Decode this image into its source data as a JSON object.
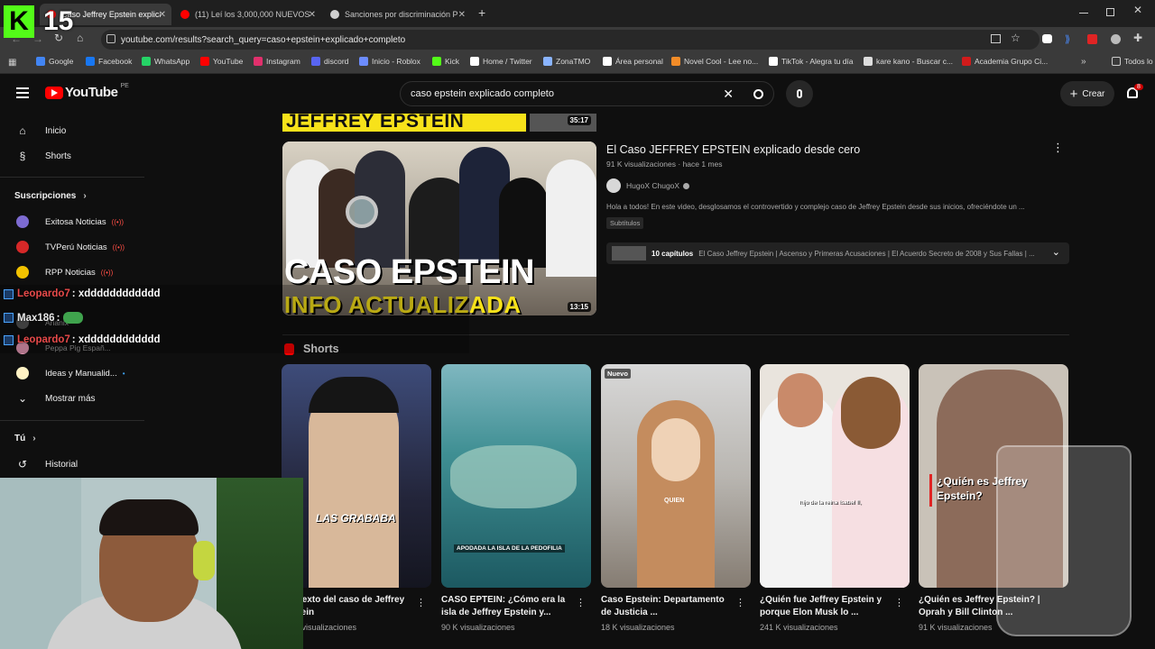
{
  "overlay": {
    "badge_letter": "K",
    "badge_number": "15"
  },
  "browser": {
    "tabs": [
      {
        "label": "Caso Jeffrey Epstein explicado com",
        "fav_color": "#ff0000"
      },
      {
        "label": "(11) Leí los 3,000,000 NUEVOS",
        "fav_color": "#ff0000"
      },
      {
        "label": "Sanciones por discriminación P",
        "fav_color": "#cfcfcf"
      }
    ],
    "new_tab": "+",
    "url": "youtube.com/results?search_query=caso+epstein+explicado+completo",
    "bookmarks": [
      {
        "label": "Google",
        "color": "#4285f4"
      },
      {
        "label": "Facebook",
        "color": "#1877f2"
      },
      {
        "label": "WhatsApp",
        "color": "#25d366"
      },
      {
        "label": "YouTube",
        "color": "#ff0000"
      },
      {
        "label": "Instagram",
        "color": "#e1306c"
      },
      {
        "label": "discord",
        "color": "#5865f2"
      },
      {
        "label": "Inicio - Roblox",
        "color": "#6c8cff"
      },
      {
        "label": "Kick",
        "color": "#53fc18"
      },
      {
        "label": "Home / Twitter",
        "color": "#ffffff"
      },
      {
        "label": "ZonaTMO",
        "color": "#8ab4ff"
      },
      {
        "label": "Área personal",
        "color": "#ffffff"
      },
      {
        "label": "Novel Cool - Lee no...",
        "color": "#f28c28"
      },
      {
        "label": "TikTok - Alegra tu día",
        "color": "#ffffff"
      },
      {
        "label": "kare kano - Buscar c...",
        "color": "#dddddd"
      },
      {
        "label": "Academia Grupo Ci...",
        "color": "#d11b1b"
      }
    ],
    "all_bookmarks": "Todos lo"
  },
  "youtube": {
    "logo_text": "YouTube",
    "region": "PE",
    "search_query": "caso epstein explicado completo",
    "create_label": "Crear",
    "notif_count": "8"
  },
  "sidebar": {
    "inicio": "Inicio",
    "shorts": "Shorts",
    "subs_header": "Suscripciones",
    "subs": [
      {
        "label": "Exitosa Noticias",
        "color": "#7d6bd1"
      },
      {
        "label": "TVPerú Noticias",
        "color": "#d62828"
      },
      {
        "label": "RPP Noticias",
        "color": "#f2c200"
      }
    ],
    "hidden_a": "Arianix",
    "hidden_b": "Peppa Pig Españ...",
    "ideas": "Ideas y Manualid...",
    "mostrar": "Mostrar más",
    "tu": "Tú",
    "historial": "Historial"
  },
  "video": {
    "banner_text": "JEFFREY EPSTEIN",
    "banner_duration": "35:17",
    "title": "El Caso JEFFREY EPSTEIN explicado desde cero",
    "meta": "91 K visualizaciones · hace 1 mes",
    "channel": "HugoX ChugoX",
    "description": "Hola a todos! En este video, desglosamos el controvertido y complejo caso de Jeffrey Epstein desde sus inicios, ofreciéndote un ...",
    "badge": "Subtítulos",
    "chapters_label": "10 capítulos",
    "chapters_text": "El Caso Jeffrey Epstein | Ascenso y Primeras Acusaciones | El Acuerdo Secreto de 2008 y Sus Fallas | ...",
    "thumb_line1": "CASO EPSTEIN",
    "thumb_line2": "INFO ACTUALIZADA",
    "duration": "13:15"
  },
  "shorts_section": {
    "title": "Shorts",
    "items": [
      {
        "title": "Contexto del caso de Jeffrey Epstein",
        "views": "M de visualizaciones",
        "overlay": "LAS GRABABA",
        "badge": ""
      },
      {
        "title": "CASO EPTEIN: ¿Cómo era la isla de Jeffrey Epstein y...",
        "views": "90 K visualizaciones",
        "overlay": "APODADA LA ISLA DE LA PEDOFILIA",
        "badge": ""
      },
      {
        "title": "Caso Epstein: Departamento de Justicia ...",
        "views": "18 K visualizaciones",
        "overlay": "QUIEN",
        "badge": "Nuevo"
      },
      {
        "title": "¿Quién fue Jeffrey Epstein y porque Elon Musk lo ...",
        "views": "241 K visualizaciones",
        "overlay": "hijo de la reina Isabel II,",
        "badge": ""
      },
      {
        "title": "¿Quién es Jeffrey Epstein? | Oprah y Bill Clinton ...",
        "views": "91 K visualizaciones",
        "overlay": "¿Quién es Jeffrey Epstein?",
        "badge": ""
      }
    ]
  },
  "chat": [
    {
      "user": "Leopardo7",
      "msg": ": xdddddddddddd"
    },
    {
      "user": "Max186",
      "msg": ":"
    },
    {
      "user": "Leopardo7",
      "msg": ": xdddddddddddd"
    }
  ],
  "colors": {
    "accent": "#ff0000",
    "bg": "#0f0f0f",
    "kick_green": "#53fc18"
  }
}
